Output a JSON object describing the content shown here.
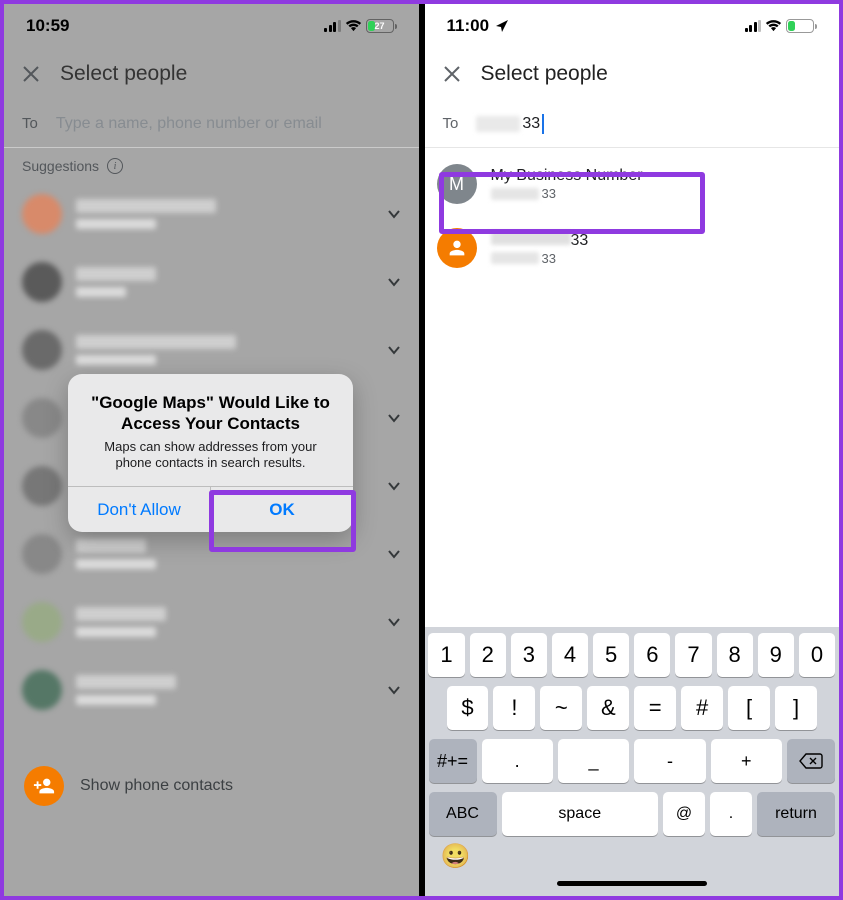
{
  "left": {
    "status": {
      "time": "10:59",
      "battery_pct": "27",
      "battery_fill_pct": 27
    },
    "appbar": {
      "title": "Select people"
    },
    "to": {
      "label": "To",
      "placeholder": "Type a name, phone number or email"
    },
    "suggestions_label": "Suggestions",
    "show_contacts": "Show phone contacts",
    "alert": {
      "title": "\"Google Maps\" Would Like to Access Your Contacts",
      "message": "Maps can show addresses from your phone contacts in search results.",
      "dont_allow": "Don't Allow",
      "ok": "OK"
    }
  },
  "right": {
    "status": {
      "time": "11:00",
      "battery_pct": "28",
      "battery_fill_pct": 28
    },
    "appbar": {
      "title": "Select people"
    },
    "to": {
      "label": "To",
      "typed_suffix": "33"
    },
    "results": [
      {
        "avatar_letter": "M",
        "avatar_style": "gray",
        "name": "My Business Number",
        "sub_suffix": "33"
      },
      {
        "avatar_letter": "",
        "avatar_style": "orange",
        "name_suffix": "33",
        "sub_suffix": "33"
      }
    ],
    "keyboard": {
      "row1": [
        "1",
        "2",
        "3",
        "4",
        "5",
        "6",
        "7",
        "8",
        "9",
        "0"
      ],
      "row2": [
        "$",
        "!",
        "~",
        "&",
        "=",
        "#",
        "[",
        "]"
      ],
      "shift": "#+=",
      "row3": [
        ".",
        "_",
        "-",
        "+"
      ],
      "row4": {
        "abc": "ABC",
        "space": "space",
        "at": "@",
        "dot": ".",
        "ret": "return"
      }
    }
  }
}
